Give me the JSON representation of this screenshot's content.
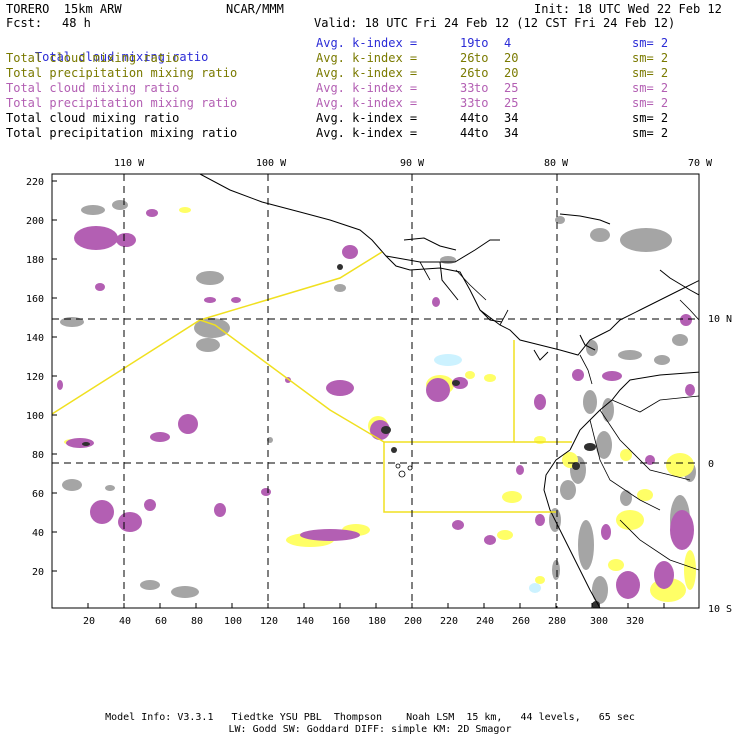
{
  "header": {
    "model": "TORERO  15km ARW",
    "org": "NCAR/MMM",
    "init": "Init: 18 UTC Wed 22 Feb 12",
    "fcst_label": "Fcst:",
    "fcst_value": "48 h",
    "valid": "Valid: 18 UTC Fri 24 Feb 12 (12 CST Fri 24 Feb 12)"
  },
  "legend": [
    {
      "field": "Total cloud mixing ratio",
      "avg": "Avg. k-index =",
      "a": "19",
      "to": "to",
      "b": "4",
      "sm": "sm= 2",
      "color": "#2b2bd6"
    },
    {
      "field": "Total cloud mixing ratio",
      "avg": "Avg. k-index =",
      "a": "26",
      "to": "to",
      "b": "20",
      "sm": "sm= 2",
      "color": "#7a7a00"
    },
    {
      "field": "Total precipitation mixing ratio",
      "avg": "Avg. k-index =",
      "a": "26",
      "to": "to",
      "b": "20",
      "sm": "sm= 2",
      "color": "#7a7a00"
    },
    {
      "field": "Total cloud mixing ratio",
      "avg": "Avg. k-index =",
      "a": "33",
      "to": "to",
      "b": "25",
      "sm": "sm= 2",
      "color": "#b35fb3"
    },
    {
      "field": "Total precipitation mixing ratio",
      "avg": "Avg. k-index =",
      "a": "33",
      "to": "to",
      "b": "25",
      "sm": "sm= 2",
      "color": "#b35fb3"
    },
    {
      "field": "Total cloud mixing ratio",
      "avg": "Avg. k-index =",
      "a": "44",
      "to": "to",
      "b": "34",
      "sm": "sm= 2",
      "color": "#000000"
    },
    {
      "field": "Total precipitation mixing ratio",
      "avg": "Avg. k-index =",
      "a": "44",
      "to": "to",
      "b": "34",
      "sm": "sm= 2",
      "color": "#000000"
    }
  ],
  "axes": {
    "lon_labels": [
      "110 W",
      "100 W",
      "90 W",
      "80 W",
      "70 W"
    ],
    "lat_labels": [
      "10 N",
      "0",
      "10 S"
    ],
    "y_ticks": [
      "220",
      "200",
      "180",
      "160",
      "140",
      "120",
      "100",
      "80",
      "60",
      "40",
      "20"
    ],
    "x_ticks": [
      "20",
      "40",
      "60",
      "80",
      "100",
      "120",
      "140",
      "160",
      "180",
      "200",
      "220",
      "240",
      "260",
      "280",
      "300",
      "320"
    ]
  },
  "colors": {
    "yellow": "#ffff66",
    "purple": "#b35fb3",
    "gray": "#a0a0a0",
    "dark": "#303030",
    "cyan": "#ccf2ff",
    "route": "#f0e020"
  },
  "footer": {
    "line1": "Model Info: V3.3.1   Tiedtke YSU PBL  Thompson    Noah LSM  15 km,   44 levels,   65 sec",
    "line2": "LW: Godd SW: Goddard DIFF: simple KM: 2D Smagor"
  }
}
